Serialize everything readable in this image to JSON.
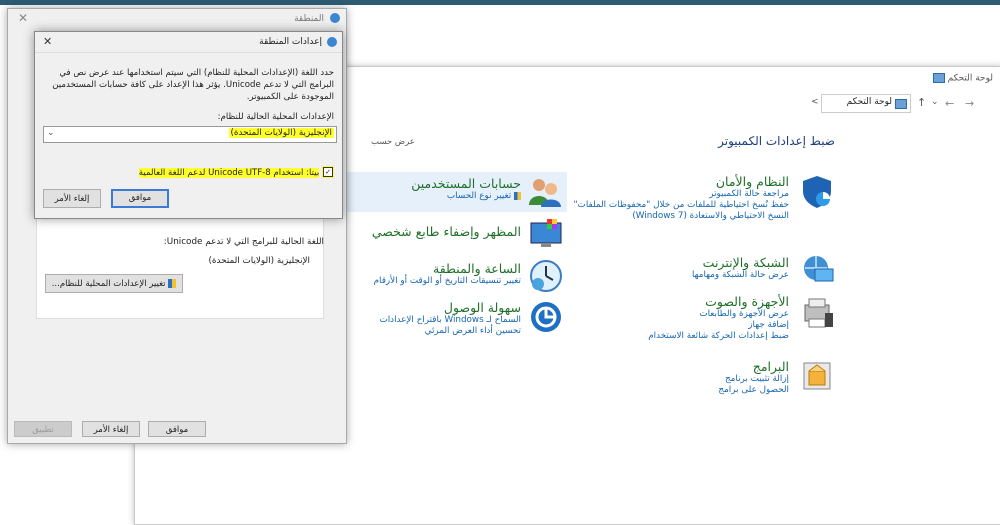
{
  "control_panel": {
    "window_title": "لوحة التحكم",
    "address": "لوحة التحكم",
    "heading": "ضبط إعدادات الكمبيوتر",
    "view_by": "عرض حسب",
    "categories_right": [
      {
        "title": "النظام والأمان",
        "links": [
          "مراجعة حالة الكمبيوتر",
          "حفظ نُسخ احتياطية للملفات من خلال \"محفوظات الملفات\"",
          "النسخ الاحتياطي والاستعادة (Windows 7)"
        ]
      },
      {
        "title": "الشبكة والإنترنت",
        "links": [
          "عرض حالة الشبكة ومهامها"
        ]
      },
      {
        "title": "الأجهزة والصوت",
        "links": [
          "عرض الأجهزة والطابعات",
          "إضافة جهاز",
          "ضبط إعدادات الحركة شائعة الاستخدام"
        ]
      },
      {
        "title": "البرامج",
        "links": [
          "إزالة تثبيت برنامج",
          "الحصول على برامج"
        ]
      }
    ],
    "categories_left": [
      {
        "title": "حسابات المستخدمين",
        "links": [
          "تغيير نوع الحساب"
        ]
      },
      {
        "title": "المظهر وإضفاء طابع شخصي",
        "links": []
      },
      {
        "title": "الساعة والمنطقة",
        "links": [
          "تغيير تنسيقات التاريخ أو الوقت أو الأرقام"
        ]
      },
      {
        "title": "سهولة الوصول",
        "links": [
          "السماح لـ Windows باقتراح الإعدادات",
          "تحسين أداء العرض المرئي"
        ]
      }
    ]
  },
  "region_dialog": {
    "title": "المنطقة",
    "current_label": "اللغة الحالية للبرامج التي لا تدعم Unicode:",
    "current_value": "الإنجليزية (الولايات المتحدة)",
    "change_button": "تغيير الإعدادات المحلية للنظام...",
    "ok": "موافق",
    "cancel": "إلغاء الأمر",
    "apply": "تطبيق"
  },
  "settings_dialog": {
    "title": "إعدادات المنطقة",
    "description": "حدد اللغة (الإعدادات المحلية للنظام) التي سيتم استخدامها عند عرض نص في البرامج التي لا تدعم Unicode. يؤثر هذا الإعداد على كافة حسابات المستخدمين الموجودة على الكمبيوتر.",
    "locale_label": "الإعدادات المحلية الحالية للنظام:",
    "locale_value": "الإنجليزية (الولايات المتحدة)",
    "beta_label": "بيتا: استخدام Unicode UTF-8 لدعم اللغة العالمية",
    "beta_checked": true,
    "ok": "موافق",
    "cancel": "إلغاء الأمر"
  },
  "colors": {
    "topbar": "#2d5c74",
    "category_title": "#1e6f28",
    "link": "#1565b0",
    "highlight": "#ffff2e"
  }
}
